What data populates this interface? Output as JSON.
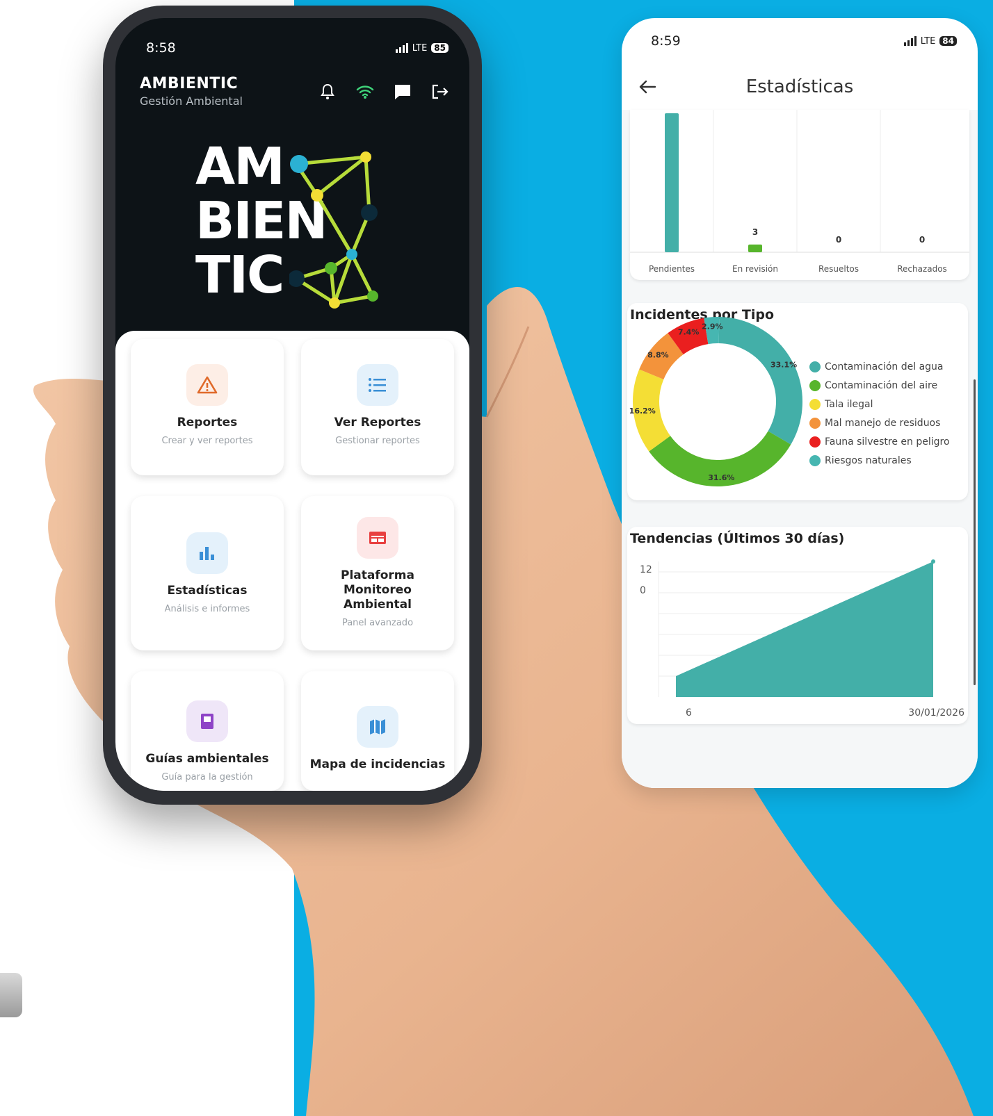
{
  "colors": {
    "background_blue": "#0aaee3",
    "teal": "#43afa8",
    "green": "#57b52c",
    "yellow": "#f4de35",
    "orange": "#f3933b",
    "red": "#ea1f1f",
    "teal2": "#46b6b1"
  },
  "home": {
    "status": {
      "time": "8:58",
      "network": "LTE",
      "battery": "85"
    },
    "app_title": "AMBIENTIC",
    "app_subtitle": "Gestión Ambiental",
    "header_icons": [
      "bell-icon",
      "wifi-icon",
      "chat-icon",
      "logout-icon"
    ],
    "logo": {
      "line1": "AM",
      "line2": "BIEN",
      "line3": "TIC"
    },
    "cards": [
      {
        "title": "Reportes",
        "subtitle": "Crear y ver reportes",
        "icon": "warning-icon",
        "color": "#fdeee6"
      },
      {
        "title": "Ver Reportes",
        "subtitle": "Gestionar reportes",
        "icon": "list-icon",
        "color": "#e4f1fb"
      },
      {
        "title": "Estadísticas",
        "subtitle": "Análisis e informes",
        "icon": "bar-chart-icon",
        "color": "#e4f1fb"
      },
      {
        "title": "Plataforma Monitoreo Ambiental",
        "subtitle": "Panel avanzado",
        "icon": "monitor-icon",
        "color": "#fde7e7"
      },
      {
        "title": "Guías ambientales",
        "subtitle": "Guía para la gestión",
        "icon": "book-icon",
        "color": "#efe6f8"
      },
      {
        "title": "Mapa de incidencias",
        "subtitle": "",
        "icon": "map-icon",
        "color": "#e4f1fb"
      }
    ]
  },
  "stats": {
    "status": {
      "time": "8:59",
      "network": "LTE",
      "battery": "84"
    },
    "title": "Estadísticas",
    "chart_data": [
      {
        "type": "bar",
        "categories": [
          "Pendientes",
          "En revisión",
          "Resueltos",
          "Rechazados"
        ],
        "values": [
          54,
          3,
          0,
          0
        ],
        "value_labels": [
          "",
          "3",
          "0",
          "0"
        ],
        "colors": [
          "#43afa8",
          "#57b52c",
          "#f4de35",
          "#f3933b"
        ]
      },
      {
        "type": "pie",
        "title": "Incidentes por Tipo",
        "categories": [
          "Contaminación del agua",
          "Contaminación del aire",
          "Tala ilegal",
          "Mal manejo de residuos",
          "Fauna silvestre en peligro",
          "Riesgos naturales"
        ],
        "values": [
          33.1,
          31.6,
          16.2,
          8.8,
          7.4,
          2.9
        ],
        "labels": [
          "33.1%",
          "31.6%",
          "16.2%",
          "8.8%",
          "7.4%",
          "2.9%"
        ],
        "colors": [
          "#43afa8",
          "#57b52c",
          "#f4de35",
          "#f3933b",
          "#ea1f1f",
          "#46b6b1"
        ],
        "legend": "right"
      },
      {
        "type": "area",
        "title": "Tendencias (Últimos 30 días)",
        "x": [
          "6",
          "30/01/2026"
        ],
        "y": [
          0,
          12
        ],
        "yticks": [
          "12",
          "0"
        ],
        "color": "#43afa8"
      }
    ]
  }
}
